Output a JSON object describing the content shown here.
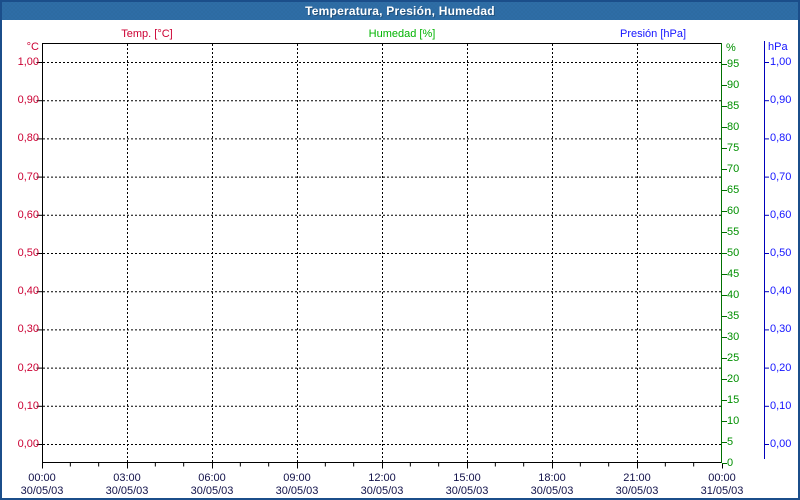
{
  "window": {
    "title": "Temperatura, Presión, Humedad"
  },
  "legend": {
    "temp": "Temp. [°C]",
    "humidity": "Humedad [%]",
    "pressure": "Presión [hPa]"
  },
  "axes": {
    "temp": {
      "unit": "°C",
      "tick_labels": [
        "1,00",
        "0,90",
        "0,80",
        "0,70",
        "0,60",
        "0,50",
        "0,40",
        "0,30",
        "0,20",
        "0,10",
        "0,00"
      ]
    },
    "humidity": {
      "unit": "%",
      "tick_labels": [
        "95",
        "90",
        "85",
        "80",
        "75",
        "70",
        "65",
        "60",
        "55",
        "50",
        "45",
        "40",
        "35",
        "30",
        "25",
        "20",
        "15",
        "10",
        "5",
        "0"
      ]
    },
    "pressure": {
      "unit": "hPa",
      "tick_labels": [
        "1,00",
        "0,90",
        "0,80",
        "0,70",
        "0,60",
        "0,50",
        "0,40",
        "0,30",
        "0,20",
        "0,10",
        "0,00"
      ]
    },
    "time": {
      "tick_times": [
        "00:00",
        "03:00",
        "06:00",
        "09:00",
        "12:00",
        "15:00",
        "18:00",
        "21:00",
        "00:00"
      ],
      "tick_dates": [
        "30/05/03",
        "30/05/03",
        "30/05/03",
        "30/05/03",
        "30/05/03",
        "30/05/03",
        "30/05/03",
        "30/05/03",
        "31/05/03"
      ]
    }
  },
  "chart_data": {
    "type": "line",
    "title": "Temperatura, Presión, Humedad",
    "x_axis": {
      "start": "30/05/03 00:00",
      "end": "31/05/03 00:00",
      "major_tick_interval_hours": 3,
      "minor_tick_interval_hours": 1,
      "tick_labels": [
        "00:00",
        "03:00",
        "06:00",
        "09:00",
        "12:00",
        "15:00",
        "18:00",
        "21:00",
        "00:00"
      ],
      "tick_dates": [
        "30/05/03",
        "30/05/03",
        "30/05/03",
        "30/05/03",
        "30/05/03",
        "30/05/03",
        "30/05/03",
        "30/05/03",
        "31/05/03"
      ]
    },
    "y_axes": [
      {
        "name": "Temp.",
        "unit": "°C",
        "side": "left",
        "min": 0.0,
        "max": 1.0,
        "tick_step": 0.1,
        "color": "#cc0033"
      },
      {
        "name": "Humedad",
        "unit": "%",
        "side": "right",
        "min": 0,
        "max": 100,
        "tick_step": 5,
        "color": "#009000"
      },
      {
        "name": "Presión",
        "unit": "hPa",
        "side": "right-outer",
        "min": 0.0,
        "max": 1.0,
        "tick_step": 0.1,
        "color": "#1414ff"
      }
    ],
    "series": [
      {
        "name": "Temp. [°C]",
        "color": "#cc0033",
        "values": []
      },
      {
        "name": "Humedad [%]",
        "color": "#00b400",
        "values": []
      },
      {
        "name": "Presión [hPa]",
        "color": "#1414ff",
        "values": []
      }
    ],
    "grid": true,
    "legend_position": "top"
  },
  "colors": {
    "titlebar_bg": "#2e6da6",
    "window_border": "#1b4e8a",
    "temp_text": "#cc0033",
    "humidity_legend": "#00b400",
    "humidity_ticks": "#009000",
    "humidity_axis_line": "#007000",
    "pressure_text": "#1414ff",
    "pressure_axis_line": "#0000bb",
    "time_text": "#101049",
    "grid_line": "#000000"
  }
}
